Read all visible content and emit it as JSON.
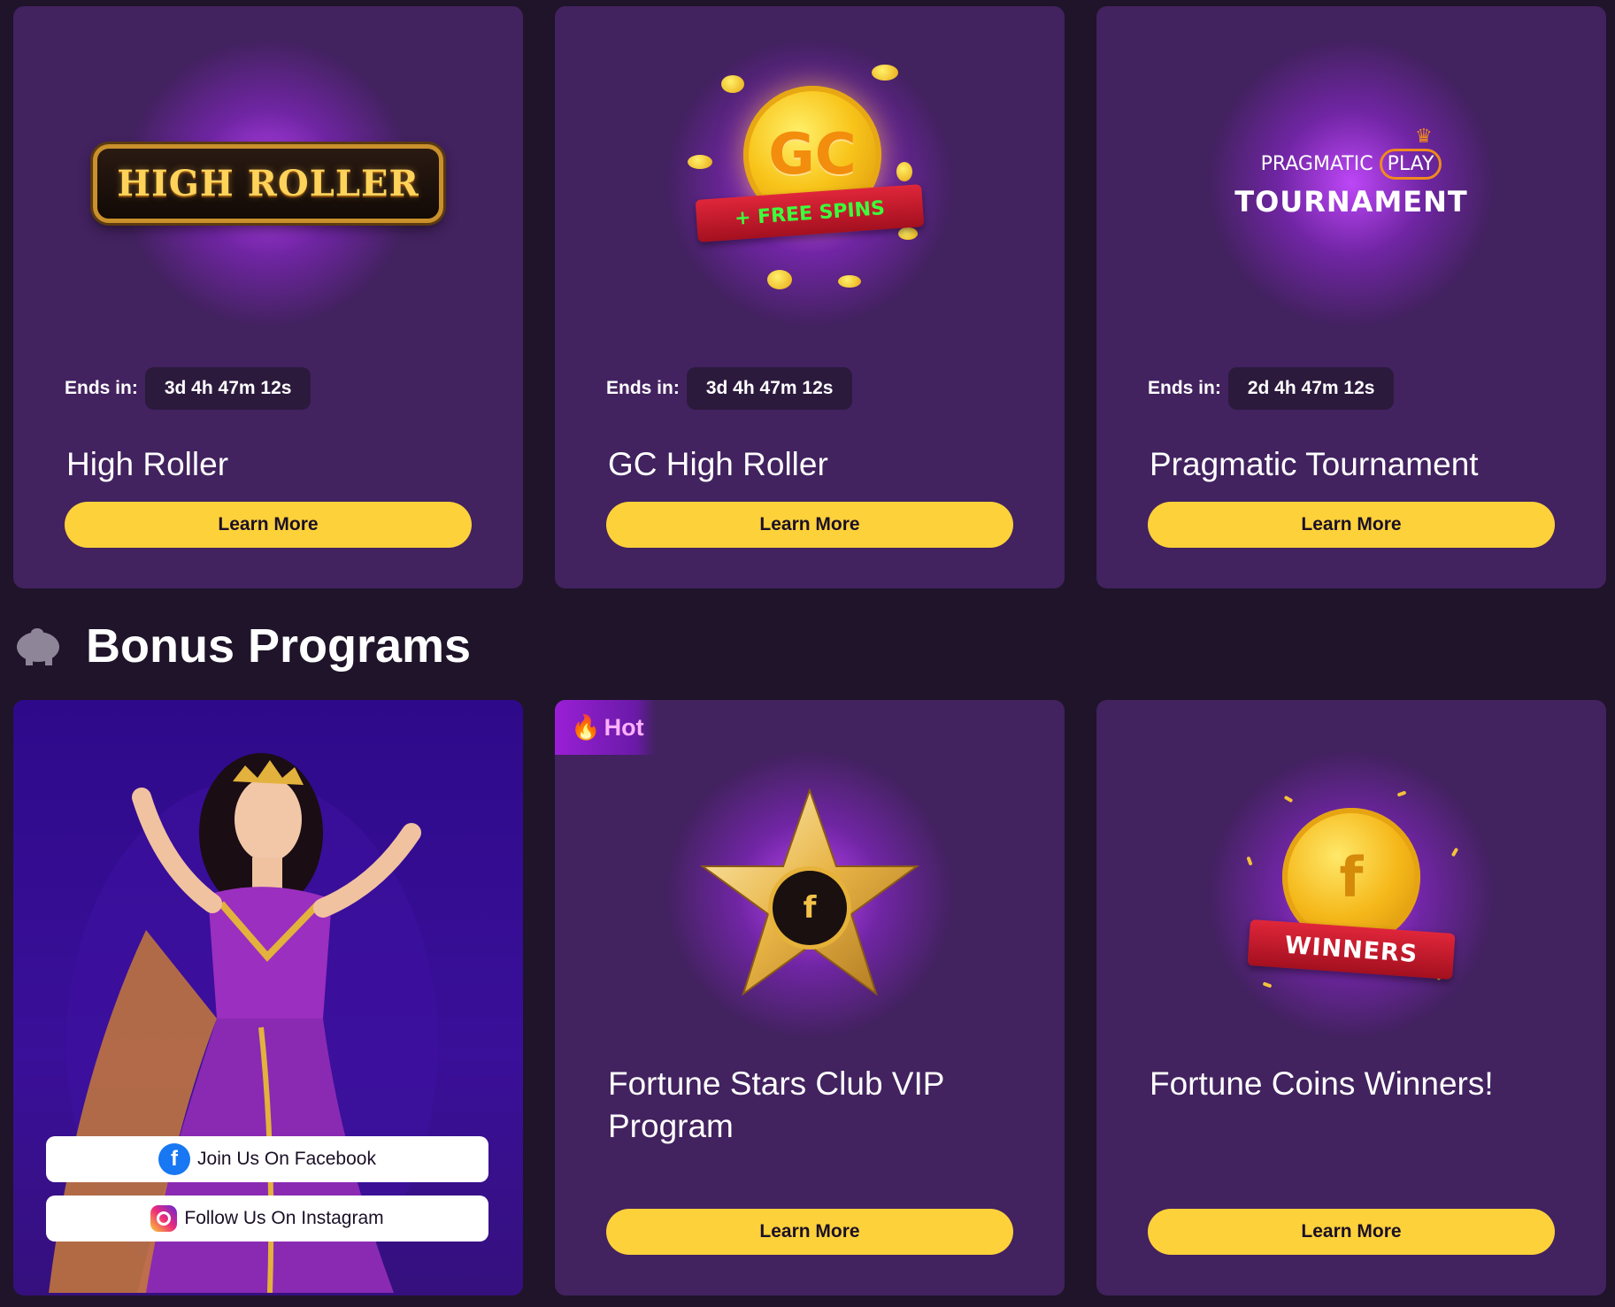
{
  "tournaments": [
    {
      "badge_text": "HIGH ROLLER",
      "ends_label": "Ends in:",
      "ends_value": "3d 4h 47m 12s",
      "title": "High Roller",
      "button": "Learn More"
    },
    {
      "badge_text": "GC",
      "ribbon_text": "+ FREE SPINS",
      "ends_label": "Ends in:",
      "ends_value": "3d 4h 47m 12s",
      "title": "GC High Roller",
      "button": "Learn More"
    },
    {
      "brand_top": "PRAGMATIC",
      "brand_play": "PLAY",
      "brand_bottom": "TOURNAMENT",
      "ends_label": "Ends in:",
      "ends_value": "2d 4h 47m 12s",
      "title": "Pragmatic Tournament",
      "button": "Learn More"
    }
  ],
  "section": {
    "icon": "piggy-bank-icon",
    "title": "Bonus Programs"
  },
  "bonus": [
    {
      "facebook": "Join Us On Facebook",
      "instagram": "Follow Us On Instagram"
    },
    {
      "tag": "Hot",
      "title": "Fortune Stars Club VIP Program",
      "button": "Learn More"
    },
    {
      "ribbon_text": "WINNERS",
      "title": "Fortune Coins Winners!",
      "button": "Learn More"
    }
  ],
  "colors": {
    "page_bg": "#1f1429",
    "card_bg": "#42225f",
    "button": "#fdd13a",
    "accent_glow": "#c448ff"
  }
}
